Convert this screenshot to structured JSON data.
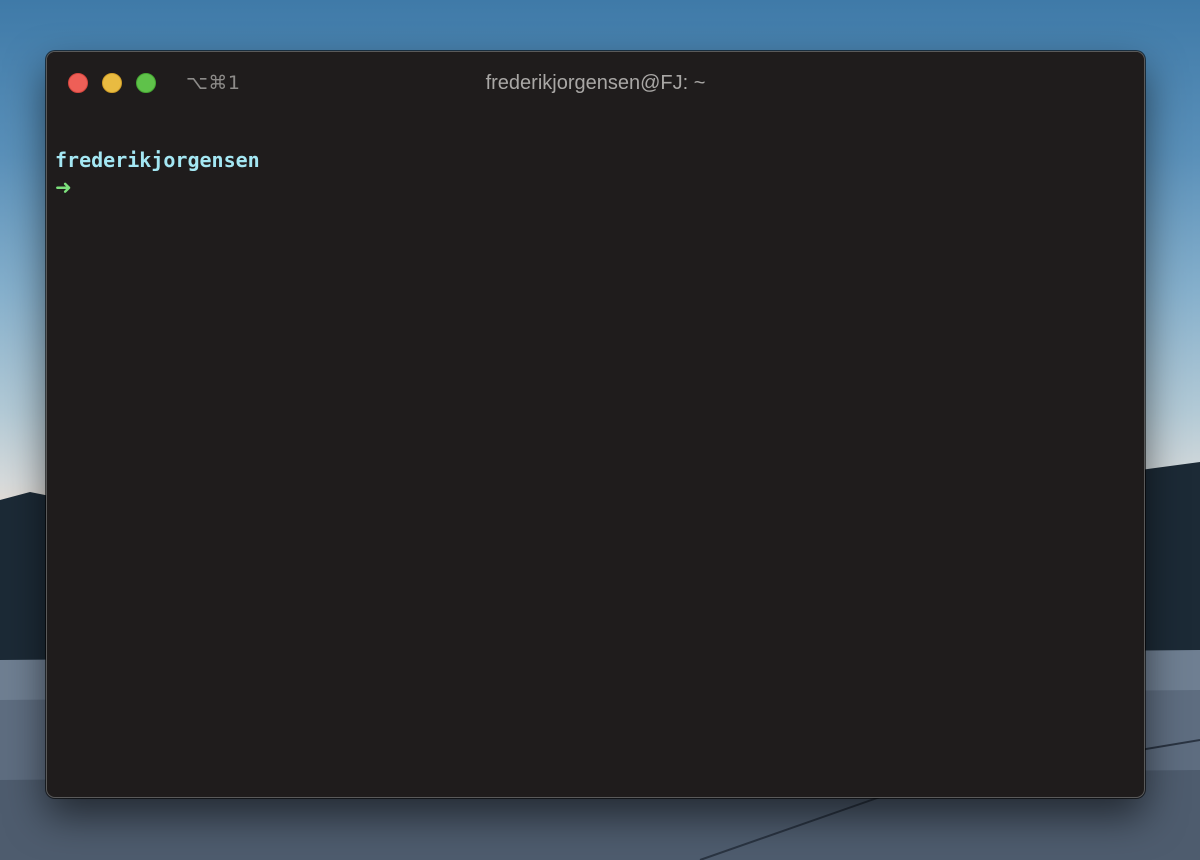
{
  "desktop": {
    "wallpaper": "mountain-lake-dusk"
  },
  "window": {
    "shortcut": "⌥⌘1",
    "title": "frederikjorgensen@FJ: ~",
    "controls": {
      "close_color": "#ee5f57",
      "minimize_color": "#e9bb41",
      "maximize_color": "#5fc24a"
    }
  },
  "terminal": {
    "prompt_user": "frederikjorgensen",
    "prompt_symbol": "➜",
    "user_color": "#a4e7f3",
    "arrow_color": "#7ce07c",
    "background": "#1f1c1c"
  }
}
